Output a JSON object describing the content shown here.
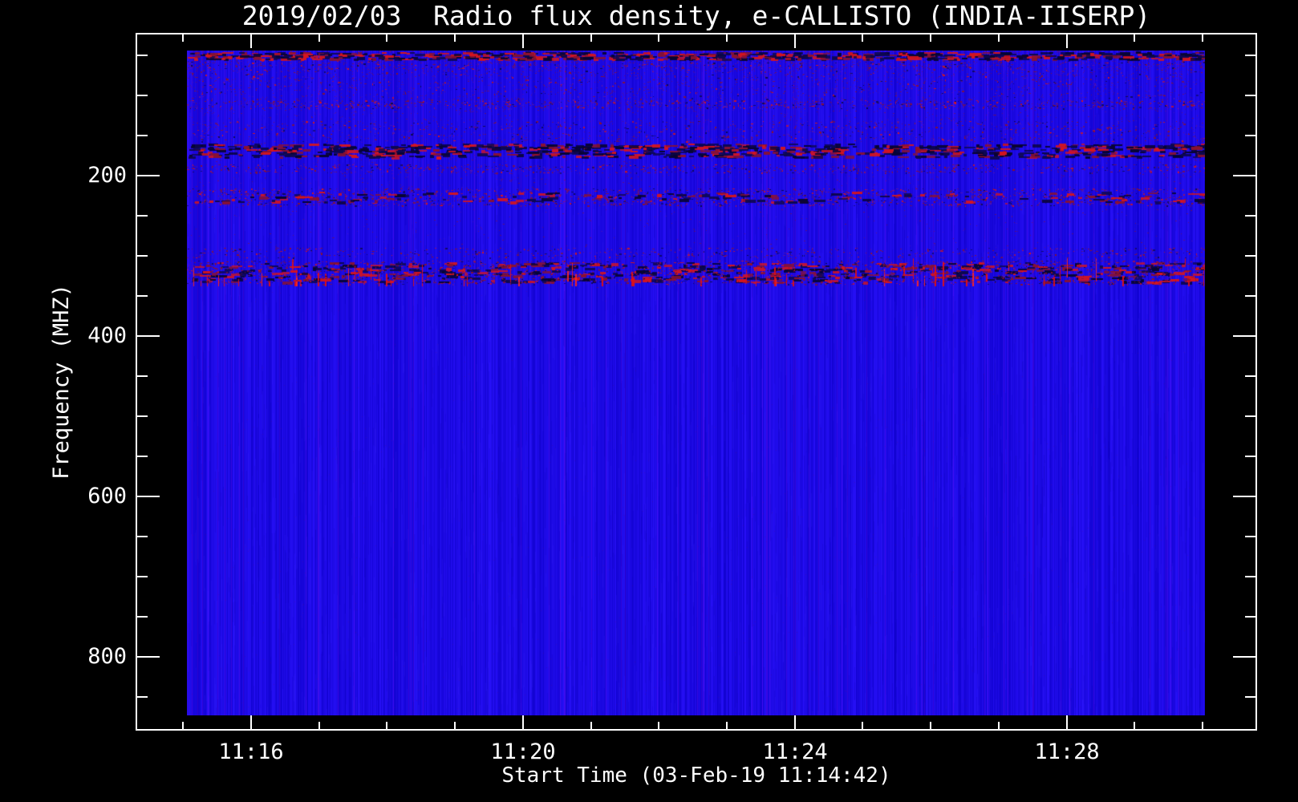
{
  "title": "2019/02/03  Radio flux density, e-CALLISTO (INDIA-IISERP)",
  "colors": {
    "background": "#000000",
    "foreground": "#ffffff"
  },
  "chart_data": {
    "type": "heatmap",
    "title": "2019/02/03  Radio flux density, e-CALLISTO (INDIA-IISERP)",
    "xlabel": "Start Time (03-Feb-19 11:14:42)",
    "ylabel": "Frequency (MHZ)",
    "x_tick_labels": [
      "11:16",
      "11:20",
      "11:24",
      "11:28"
    ],
    "x_minor_tick_interval_minutes": 1,
    "x_major_tick_interval_minutes": 4,
    "x_range_time": [
      "11:15",
      "11:30"
    ],
    "y_tick_labels": [
      "200",
      "400",
      "600",
      "800"
    ],
    "y_tick_values_mhz": [
      200,
      400,
      600,
      800
    ],
    "y_minor_step_mhz": 50,
    "y_axis_range_mhz": [
      23,
      892
    ],
    "y_data_range_mhz": [
      44,
      873
    ],
    "y_axis_inverted": true,
    "grid": false,
    "legend": "none",
    "colormap_description": "uniform saturated blue background with red/dark-navy interference noise",
    "palette": {
      "base": "#1a08dc",
      "base_dark": "#1204bc",
      "base_light": "#3119f2",
      "navy_dash": "#070433",
      "navy_dash2": "#0d0850",
      "red_bright": "#d41520",
      "red_dark": "#8a1230",
      "purple": "#5a14a8"
    },
    "noise_bands": [
      {
        "mhz_lo": 44,
        "mhz_hi": 57,
        "type": "dash",
        "density": 1.2,
        "red_ratio": 0.5
      },
      {
        "mhz_lo": 57,
        "mhz_hi": 67,
        "type": "speckle",
        "density": 0.08
      },
      {
        "mhz_lo": 67,
        "mhz_hi": 112,
        "type": "speckle",
        "density": 0.028
      },
      {
        "mhz_lo": 106,
        "mhz_hi": 117,
        "type": "speckle",
        "density": 0.11
      },
      {
        "mhz_lo": 132,
        "mhz_hi": 158,
        "type": "speckle",
        "density": 0.045
      },
      {
        "mhz_lo": 157,
        "mhz_hi": 180,
        "type": "dash",
        "density": 1.5,
        "red_ratio": 0.38
      },
      {
        "mhz_lo": 186,
        "mhz_hi": 197,
        "type": "speckle",
        "density": 0.1
      },
      {
        "mhz_lo": 216,
        "mhz_hi": 238,
        "type": "speckle",
        "density": 0.13
      },
      {
        "mhz_lo": 218,
        "mhz_hi": 236,
        "type": "dash",
        "density": 0.3,
        "red_ratio": 0.55
      },
      {
        "mhz_lo": 290,
        "mhz_hi": 303,
        "type": "speckle",
        "density": 0.07
      },
      {
        "mhz_lo": 303,
        "mhz_hi": 338,
        "type": "dash",
        "density": 1.1,
        "red_ratio": 0.5
      },
      {
        "mhz_lo": 303,
        "mhz_hi": 338,
        "type": "streaks",
        "density": 0.1
      },
      {
        "mhz_lo": 306,
        "mhz_hi": 336,
        "type": "speckle",
        "density": 0.12
      }
    ]
  }
}
